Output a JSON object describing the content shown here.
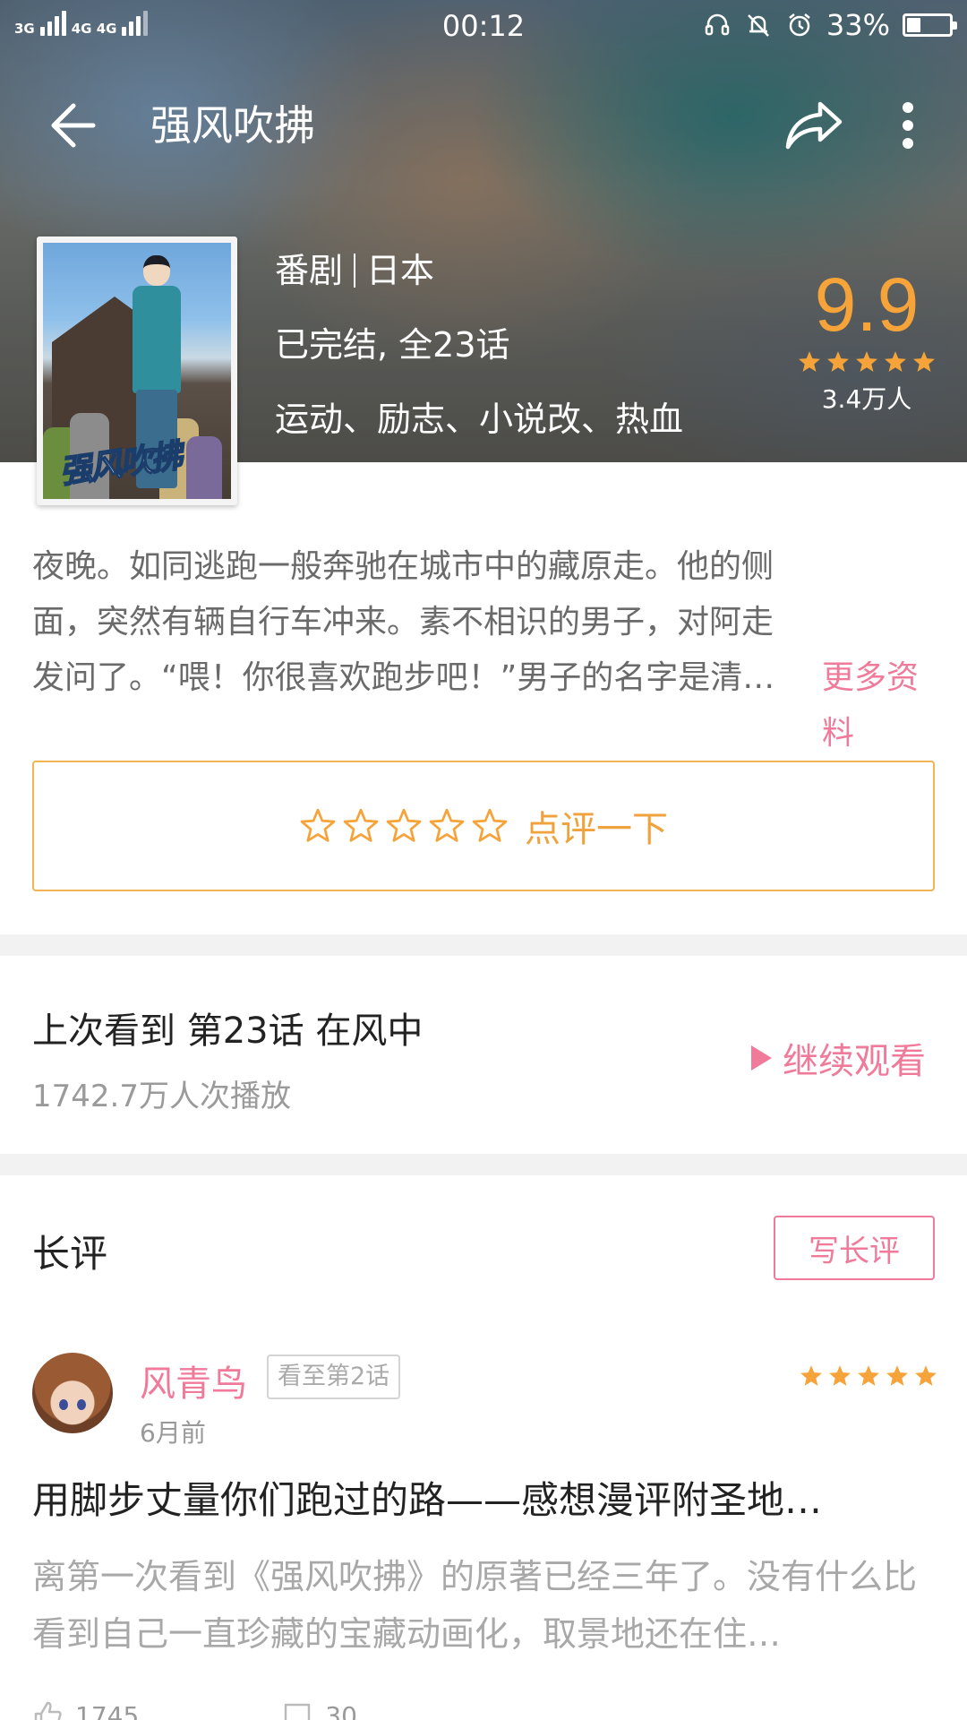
{
  "status_bar": {
    "network_left": "3G",
    "network_right": "4G 4G",
    "time": "00:12",
    "battery_percent": "33%",
    "battery_level": 0.33,
    "icons": [
      "headset-icon",
      "notification-off-icon",
      "alarm-icon",
      "battery-icon"
    ]
  },
  "top_bar": {
    "title": "强风吹拂",
    "icons": [
      "back-arrow-icon",
      "share-icon",
      "more-vertical-icon"
    ]
  },
  "info": {
    "type": "番剧",
    "region": "日本",
    "status": "已完结, 全23话",
    "tags": "运动、励志、小说改、热血",
    "score": "9.9",
    "score_stars": 5,
    "rating_count": "3.4万人",
    "poster_logo_text": "强风吹拂"
  },
  "synopsis": {
    "text": "夜晚。如同逃跑一般奔驰在城市中的藏原走。他的侧面，突然有辆自行车冲来。素不相识的男子，对阿走发问了。“喂！你很喜欢跑步吧！”男子的名字是清…",
    "more_link": "更多资料"
  },
  "rate": {
    "label": "点评一下",
    "empty_stars": 5
  },
  "progress": {
    "last_watched": "上次看到 第23话 在风中",
    "play_count": "1742.7万人次播放",
    "continue_label": "继续观看"
  },
  "long_reviews": {
    "section_title": "长评",
    "write_label": "写长评",
    "review": {
      "author": "风青鸟",
      "badge": "看至第2话",
      "date": "6月前",
      "stars": 5,
      "title": "用脚步丈量你们跑过的路——感想漫评附圣地…",
      "body": "离第一次看到《强风吹拂》的原著已经三年了。没有什么比看到自己一直珍藏的宝藏动画化，取景地还在住…",
      "likes": "1745",
      "comments": "30"
    }
  },
  "colors": {
    "accent_pink": "#f07a9a",
    "accent_orange": "#f6a33a",
    "text_gray": "#6a6a6a"
  }
}
